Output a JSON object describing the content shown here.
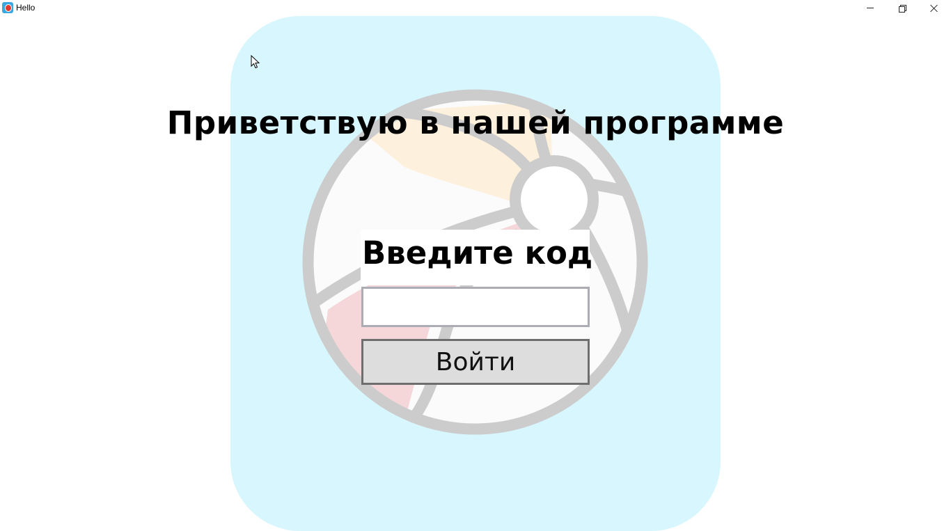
{
  "window": {
    "title": "Hello",
    "icon": "app-ball-icon",
    "controls": [
      "minimize-icon",
      "restore-icon",
      "close-icon"
    ]
  },
  "main": {
    "welcome": "Приветствую в нашей программе",
    "prompt": "Введите код",
    "code_value": "",
    "login_label": "Войти"
  },
  "colors": {
    "panel_background": "#d8f6fd",
    "button_background": "#dddddd",
    "input_border": "#acacb4"
  }
}
